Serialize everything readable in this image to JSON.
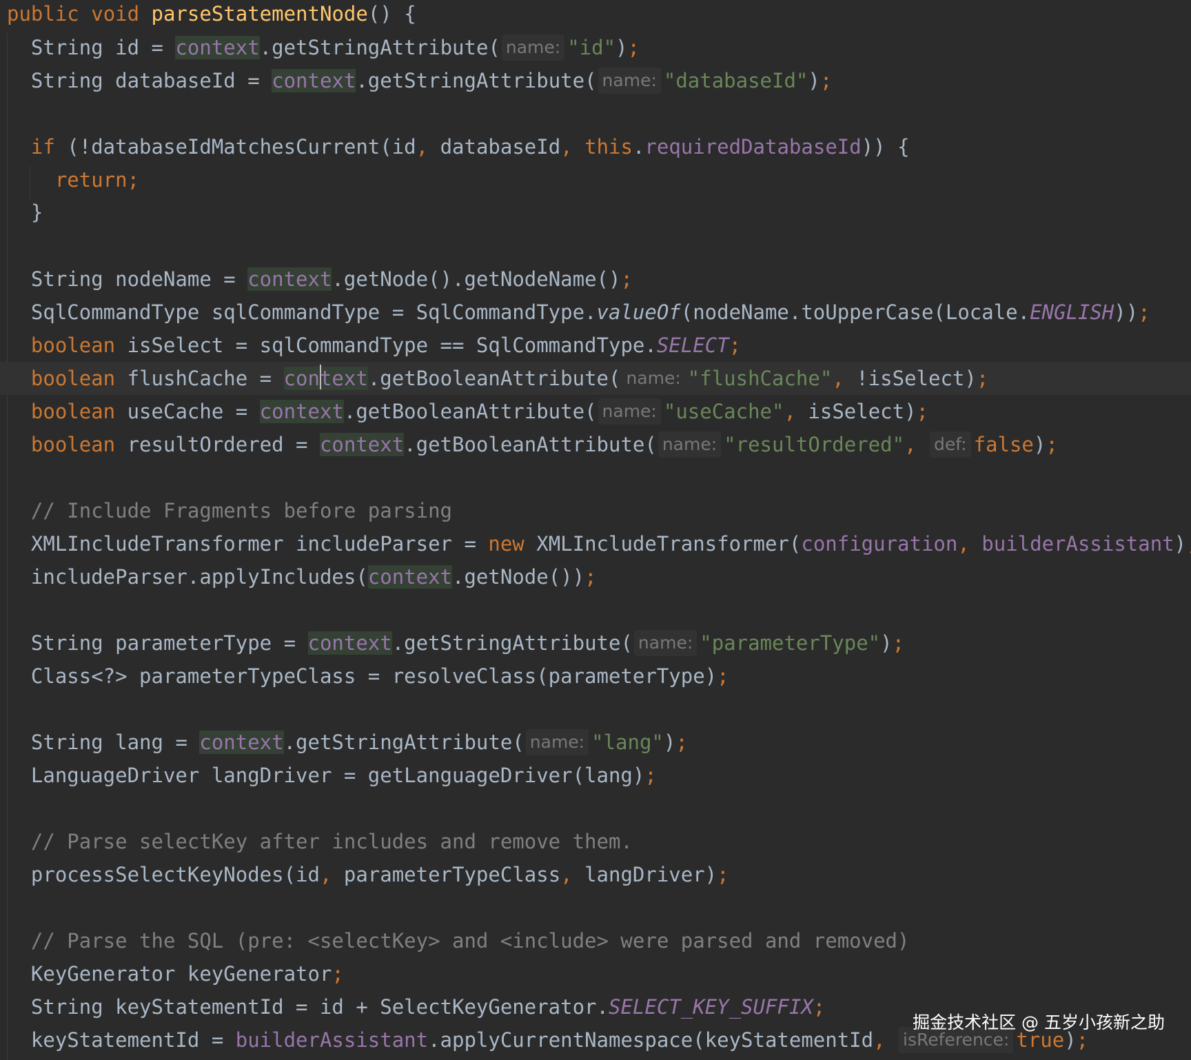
{
  "editor": {
    "theme_colors": {
      "background": "#2b2b2b",
      "current_line": "#323232",
      "keyword": "#cc7832",
      "string": "#6a8759",
      "field": "#9876aa",
      "method_declaration": "#ffc66d",
      "comment": "#808080",
      "identifier_highlight": "#344134",
      "plain_text": "#a9b7c6"
    },
    "method_signature": {
      "keyword_public": "public",
      "keyword_void": "void",
      "method_name": "parseStatementNode",
      "rest": "() {"
    },
    "tokens": {
      "String": "String ",
      "context": "context",
      "name_hint": "name:",
      "def_hint": "def:",
      "isReference_hint": "isReference:",
      "boolean": "boolean",
      "return": "return;",
      "this": "this",
      "new": "new",
      "semicolon": ";"
    },
    "line_id": {
      "a": "id = ",
      "b": ".getStringAttribute(",
      "str": "\"id\"",
      "c": ")"
    },
    "line_databaseId": {
      "a": "databaseId = ",
      "b": ".getStringAttribute(",
      "str": "\"databaseId\"",
      "c": ")"
    },
    "line_if": {
      "kw": "if",
      "a": " (!databaseIdMatchesCurrent(id",
      "comma": ",",
      "b": " databaseId",
      "c": " ",
      "d": ".",
      "fld": "requiredDatabaseId",
      "e": ")) {"
    },
    "line_close_brace": "}",
    "line_nodeName": {
      "a": "nodeName = ",
      "b": ".getNode().getNodeName()"
    },
    "line_sqlCommandType": {
      "a": "SqlCommandType sqlCommandType = SqlCommandType.",
      "it": "valueOf",
      "b": "(nodeName.toUpperCase(Locale.",
      "cst": "ENGLISH",
      "c": "))"
    },
    "line_isSelect": {
      "a": " isSelect = sqlCommandType == SqlCommandType.",
      "cst": "SELECT"
    },
    "line_flushCache": {
      "a": " flushCache = ",
      "ctx1": "con",
      "ctx2": "text",
      "b": ".getBooleanAttribute(",
      "str": "\"flushCache\"",
      "comma": ",",
      "c": " !isSelect)"
    },
    "line_useCache": {
      "a": " useCache = ",
      "b": ".getBooleanAttribute(",
      "str": "\"useCache\"",
      "comma": ",",
      "c": " isSelect)"
    },
    "line_resultOrdered": {
      "a": " resultOrdered = ",
      "b": ".getBooleanAttribute(",
      "str": "\"resultOrdered\"",
      "comma": ",",
      "val": "false",
      "c": ")"
    },
    "comment_include": "// Include Fragments before parsing",
    "line_includeParser": {
      "a": "XMLIncludeTransformer includeParser = ",
      "b": " XMLIncludeTransformer(",
      "fld1": "configuration",
      "comma": ",",
      "fld2": " builderAssistant",
      "c": ")"
    },
    "line_applyIncludes": {
      "a": "includeParser.applyIncludes(",
      "b": ".getNode())"
    },
    "line_parameterType": {
      "a": "parameterType = ",
      "b": ".getStringAttribute(",
      "str": "\"parameterType\"",
      "c": ")"
    },
    "line_parameterTypeClass": {
      "a": "Class<?> parameterTypeClass = resolveClass(parameterType)"
    },
    "line_lang": {
      "a": "lang = ",
      "b": ".getStringAttribute(",
      "str": "\"lang\"",
      "c": ")"
    },
    "line_langDriver": {
      "a": "LanguageDriver langDriver = getLanguageDriver(lang)"
    },
    "comment_selectKey": "// Parse selectKey after includes and remove them.",
    "line_processSelectKey": {
      "a": "processSelectKeyNodes(id",
      "comma": ",",
      "b": " parameterTypeClass",
      "c": " langDriver)"
    },
    "comment_sql": "// Parse the SQL (pre: <selectKey> and <include> were parsed and removed)",
    "line_keyGenerator": {
      "a": "KeyGenerator keyGenerator"
    },
    "line_keyStatementId": {
      "a": "keyStatementId = id + SelectKeyGenerator.",
      "cst": "SELECT_KEY_SUFFIX"
    },
    "line_applyNamespace": {
      "a": "keyStatementId = ",
      "fld": "builderAssistant",
      "b": ".applyCurrentNamespace(keyStatementId",
      "comma": ",",
      "val": "true",
      "c": ")"
    }
  },
  "watermark": {
    "text": "掘金技术社区 @ 五岁小孩新之助"
  }
}
